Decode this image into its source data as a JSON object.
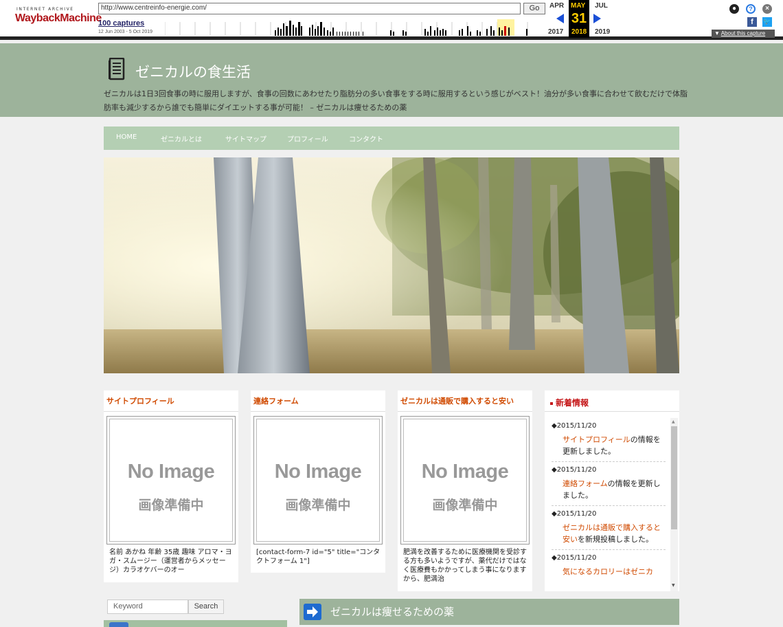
{
  "wayback": {
    "logo_top": "INTERNET ARCHIVE",
    "logo_main": "WaybackMachine",
    "url": "http://www.centreinfo-energie.com/",
    "go_label": "Go",
    "captures": "100 captures",
    "range": "12 Jun 2003 - 5 Oct 2019",
    "months": {
      "prev": "APR",
      "cur": "MAY",
      "next": "JUL"
    },
    "day": "31",
    "years": {
      "prev": "2017",
      "cur": "2018",
      "next": "2019"
    },
    "about": "About this capture",
    "facebook": "f",
    "colors": {
      "accent": "#1a4fd6",
      "highlight": "#fc0",
      "logo": "#b0161b"
    }
  },
  "site": {
    "title": "ゼニカルの食生活",
    "description": "ゼニカルは1日3回食事の時に服用しますが、食事の回数にあわせたり脂肪分の多い食事をする時に服用するという感じがベスト！油分が多い食事に合わせて飲むだけで体脂肪率も減少するから誰でも簡単にダイエットする事が可能！ – ゼニカルは痩せるための薬",
    "header_color": "#9db39b"
  },
  "nav": [
    "HOME",
    "ゼニカルとは",
    "サイトマップ",
    "プロフィール",
    "コンタクト"
  ],
  "cards": [
    {
      "title": "サイトプロフィール",
      "image_text": "No Image",
      "image_sub": "画像準備中",
      "text": "名前 あかね 年齢 35歳 趣味 アロマ・ヨガ・スムージー（運営者からメッセージ）カラオケバーのオー"
    },
    {
      "title": "連絡フォーム",
      "image_text": "No Image",
      "image_sub": "画像準備中",
      "text": "[contact-form-7 id=\"5\" title=\"コンタクトフォーム 1\"]"
    },
    {
      "title": "ゼニカルは通販で購入すると安い",
      "image_text": "No Image",
      "image_sub": "画像準備中",
      "text": "肥満を改善するために医療機関を受診する方も多いようですが、薬代だけではなく医療費もかかってしまう事になりますから、肥満治"
    }
  ],
  "news": {
    "title": "新着情報",
    "entries": [
      {
        "date": "◆2015/11/20",
        "link": "サイトプロフィール",
        "rest": "の情報を更新しました。"
      },
      {
        "date": "◆2015/11/20",
        "link": "連絡フォーム",
        "rest": "の情報を更新しました。"
      },
      {
        "date": "◆2015/11/20",
        "link": "ゼニカルは通販で購入すると安い",
        "rest": "を新規投稿しました。"
      },
      {
        "date": "◆2015/11/20",
        "link": "気になるカロリーはゼニカ",
        "rest": ""
      }
    ]
  },
  "search": {
    "placeholder": "Keyword",
    "button": "Search"
  },
  "main_heading": "ゼニカルは痩せるための薬"
}
